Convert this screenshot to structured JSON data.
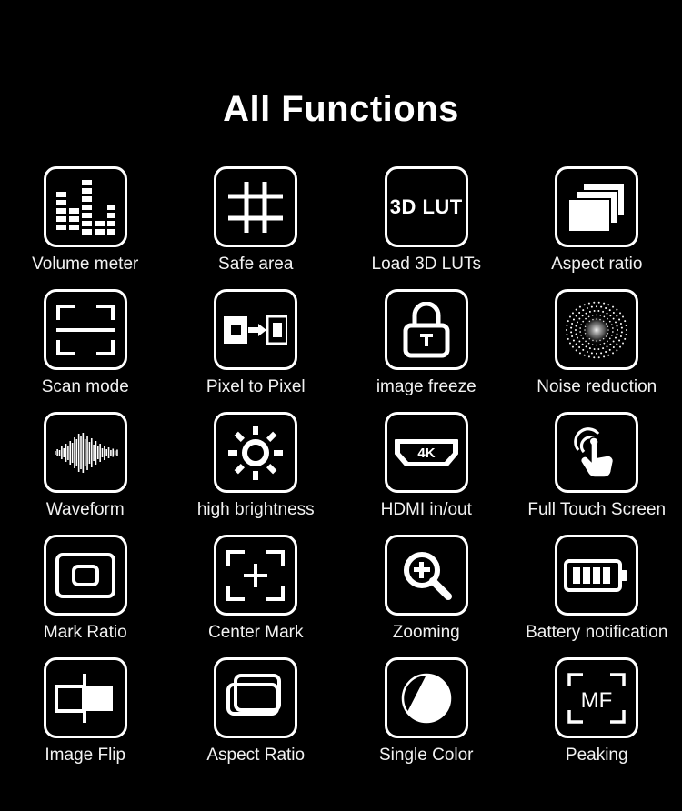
{
  "page": {
    "background_color": "#000000",
    "foreground_color": "#ffffff",
    "title": "All Functions"
  },
  "grid": {
    "columns": 4,
    "rows": 5,
    "items": [
      {
        "label": "Volume meter",
        "icon": "volume-meter-icon"
      },
      {
        "label": "Safe area",
        "icon": "safe-area-grid-icon"
      },
      {
        "label": "Load 3D LUTs",
        "icon": "3d-lut-text-icon",
        "icon_text": "3D LUT"
      },
      {
        "label": "Aspect ratio",
        "icon": "stacked-frames-icon"
      },
      {
        "label": "Scan mode",
        "icon": "scan-mode-icon"
      },
      {
        "label": "Pixel to Pixel",
        "icon": "pixel-to-pixel-icon"
      },
      {
        "label": "image freeze",
        "icon": "padlock-icon"
      },
      {
        "label": "Noise reduction",
        "icon": "radial-dots-icon"
      },
      {
        "label": "Waveform",
        "icon": "waveform-icon"
      },
      {
        "label": "high brightness",
        "icon": "sun-icon"
      },
      {
        "label": "HDMI in/out",
        "icon": "hdmi-connector-icon",
        "icon_text": "4K"
      },
      {
        "label": "Full Touch Screen",
        "icon": "touch-hand-icon"
      },
      {
        "label": "Mark Ratio",
        "icon": "nested-rectangles-icon"
      },
      {
        "label": "Center Mark",
        "icon": "center-cross-brackets-icon"
      },
      {
        "label": "Zooming",
        "icon": "magnifier-plus-icon"
      },
      {
        "label": "Battery notification",
        "icon": "battery-icon"
      },
      {
        "label": "Image Flip",
        "icon": "image-flip-icon"
      },
      {
        "label": "Aspect Ratio",
        "icon": "overlapping-frames-icon"
      },
      {
        "label": "Single Color",
        "icon": "half-filled-circle-icon"
      },
      {
        "label": "Peaking",
        "icon": "mf-brackets-icon",
        "icon_text": "MF"
      }
    ]
  }
}
